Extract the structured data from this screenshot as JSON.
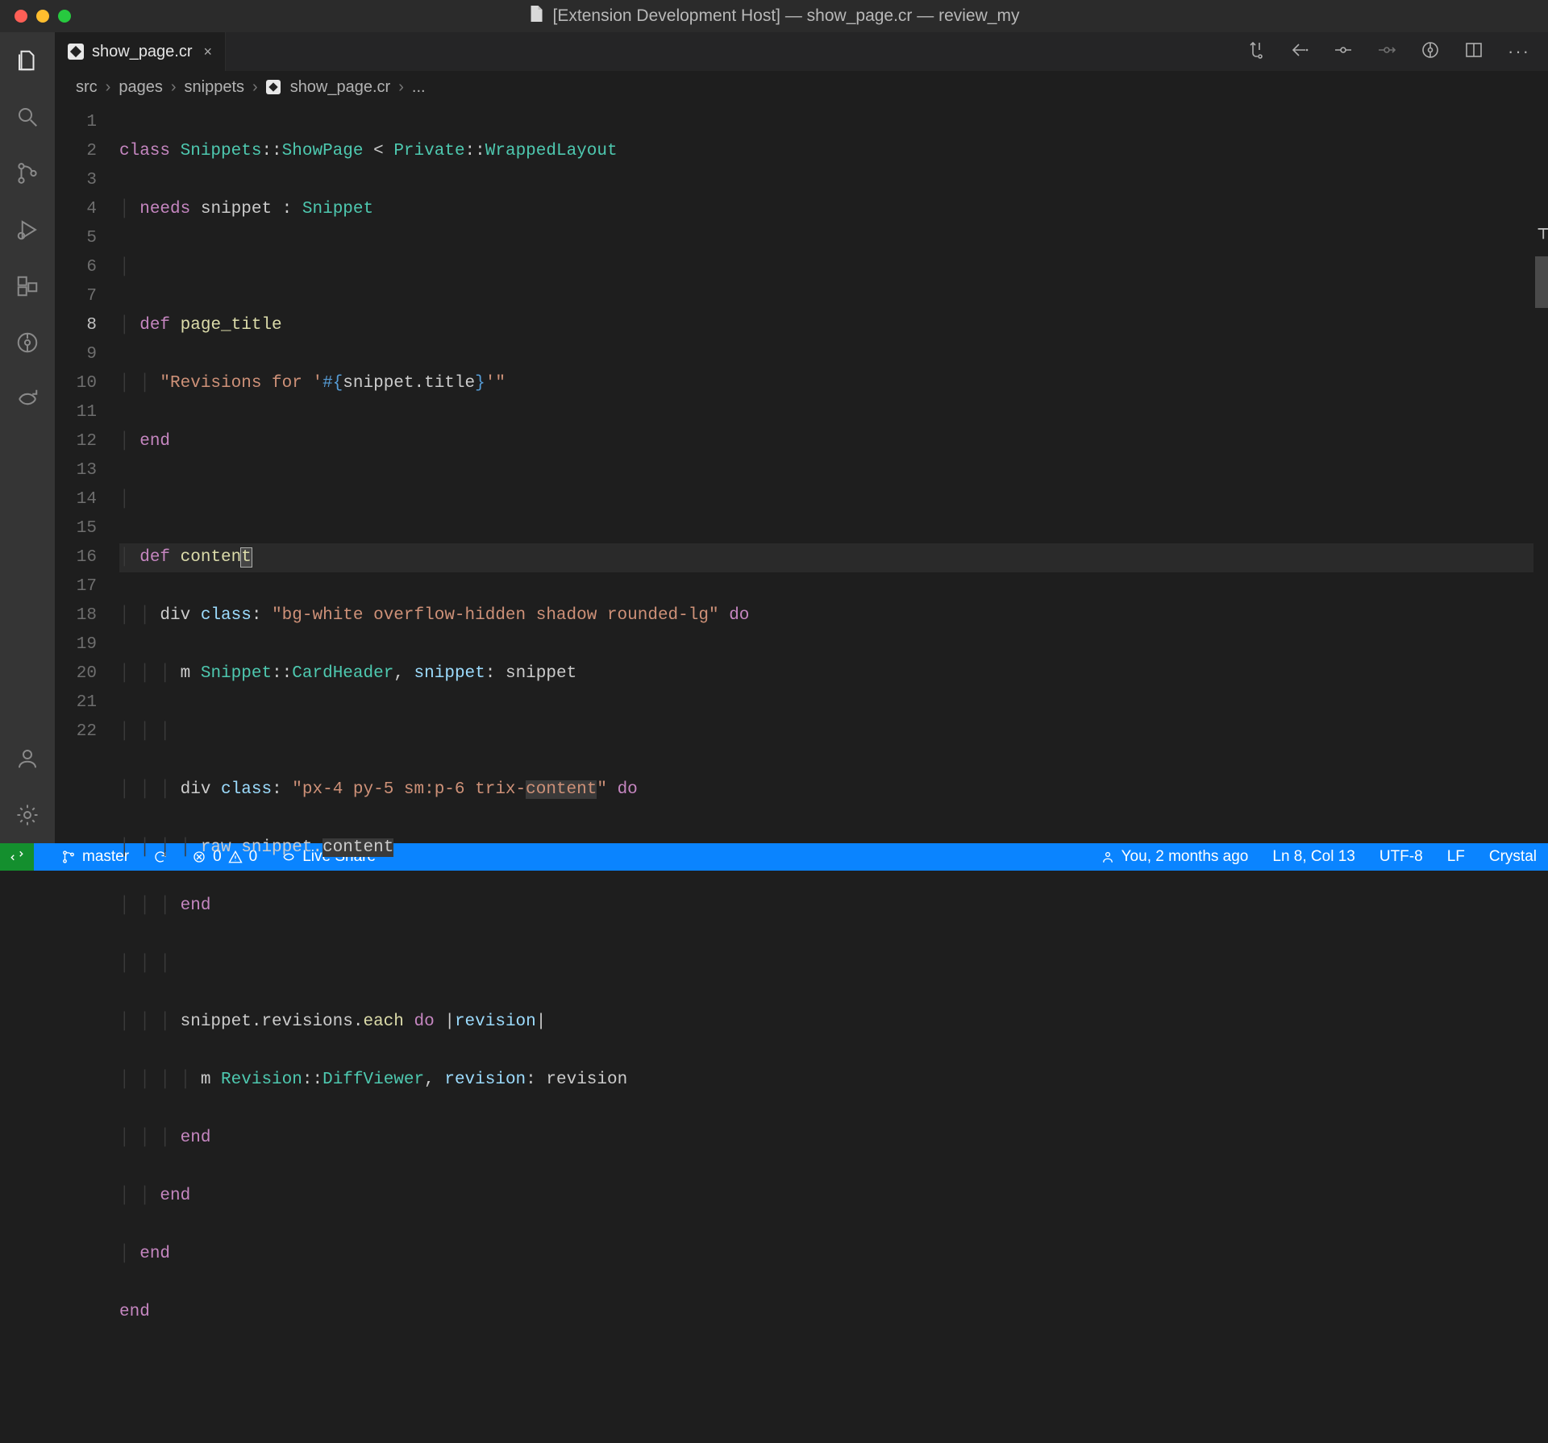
{
  "window": {
    "title": "[Extension Development Host] — show_page.cr — review_my"
  },
  "tab": {
    "filename": "show_page.cr"
  },
  "breadcrumbs": {
    "parts": [
      "src",
      "pages",
      "snippets",
      "show_page.cr",
      "..."
    ]
  },
  "status": {
    "branch": "master",
    "errors": "0",
    "warnings": "0",
    "liveshare": "Live Share",
    "blame": "You, 2 months ago",
    "position": "Ln 8, Col 13",
    "encoding": "UTF-8",
    "eol": "LF",
    "language": "Crystal"
  },
  "gutter_lines": [
    "1",
    "2",
    "3",
    "4",
    "5",
    "6",
    "7",
    "8",
    "9",
    "10",
    "11",
    "12",
    "13",
    "14",
    "15",
    "16",
    "17",
    "18",
    "19",
    "20",
    "21",
    "22"
  ],
  "code": {
    "l1": {
      "kw_class": "class",
      "name": "Snippets",
      "sep": "::",
      "page": "ShowPage",
      "lt": "<",
      "priv": "Private",
      "sep2": "::",
      "wrap": "WrappedLayout"
    },
    "l2": {
      "needs": "needs",
      "snippet": "snippet",
      "colon": ":",
      "type": "Snippet"
    },
    "l4": {
      "def": "def",
      "name": "page_title"
    },
    "l5": {
      "q1": "\"Revisions for '",
      "interp_open": "#{",
      "expr": "snippet.title",
      "interp_close": "}",
      "q2": "'\""
    },
    "l6": {
      "end": "end"
    },
    "l8": {
      "def": "def",
      "name_a": "conten",
      "name_b": "t"
    },
    "l9": {
      "div": "div",
      "classkw": "class",
      "colon": ":",
      "str": "\"bg-white overflow-hidden shadow rounded-lg\"",
      "do": "do"
    },
    "l10": {
      "m": "m",
      "mod": "Snippet",
      "sep": "::",
      "h": "CardHeader",
      "comma": ",",
      "snippet": "snippet",
      "colon": ":",
      "arg": "snippet"
    },
    "l12": {
      "div": "div",
      "classkw": "class",
      "colon": ":",
      "s1": "\"px-4 py-5 sm:p-6 trix-",
      "s2": "content",
      "s3": "\"",
      "do": "do"
    },
    "l13": {
      "raw": "raw",
      "expr_a": "snippet.",
      "expr_b": "content"
    },
    "l14": {
      "end": "end"
    },
    "l16": {
      "pre": "snippet.revisions.",
      "each": "each",
      "do": "do",
      "pipe1": "|",
      "rev": "revision",
      "pipe2": "|"
    },
    "l17": {
      "m": "m",
      "mod": "Revision",
      "sep": "::",
      "h": "DiffViewer",
      "comma": ",",
      "rev": "revision",
      "colon": ":",
      "arg": "revision"
    },
    "l18": {
      "end": "end"
    },
    "l19": {
      "end": "end"
    },
    "l20": {
      "end": "end"
    },
    "l21": {
      "end": "end"
    }
  }
}
